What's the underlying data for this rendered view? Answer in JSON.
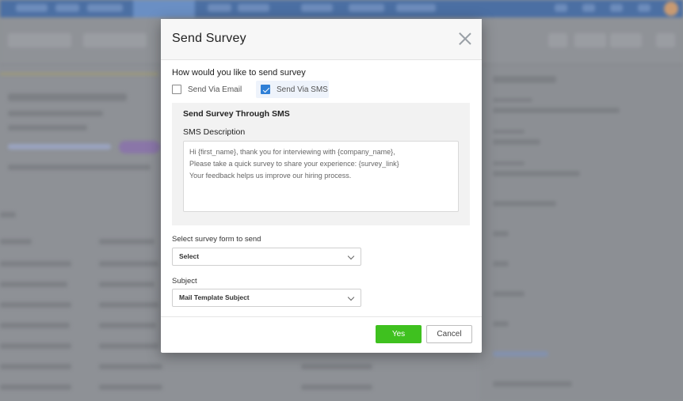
{
  "modal": {
    "title": "Send Survey",
    "question": "How would you like to send survey",
    "options": [
      {
        "label": "Send Via Email",
        "checked": false
      },
      {
        "label": "Send Via SMS",
        "checked": true
      }
    ],
    "sms_section": {
      "title": "Send Survey Through SMS",
      "description_label": "SMS Description",
      "description_lines": [
        "Hi {first_name}, thank you for interviewing with {company_name},",
        "Please take a quick survey to share your experience: {survey_link}",
        "Your feedback helps us improve our hiring process."
      ]
    },
    "survey_form": {
      "label": "Select survey form to send",
      "value": "Select"
    },
    "subject": {
      "label": "Subject",
      "value": "Mail Template Subject"
    },
    "buttons": {
      "yes": "Yes",
      "cancel": "Cancel"
    }
  },
  "colors": {
    "primary_button": "#3fc11f",
    "checkbox_checked": "#2f7fd6",
    "overlay": "#8e9196"
  },
  "icons": {
    "close": "close-icon",
    "dropdown": "chevron-down-icon",
    "check": "check-icon"
  }
}
